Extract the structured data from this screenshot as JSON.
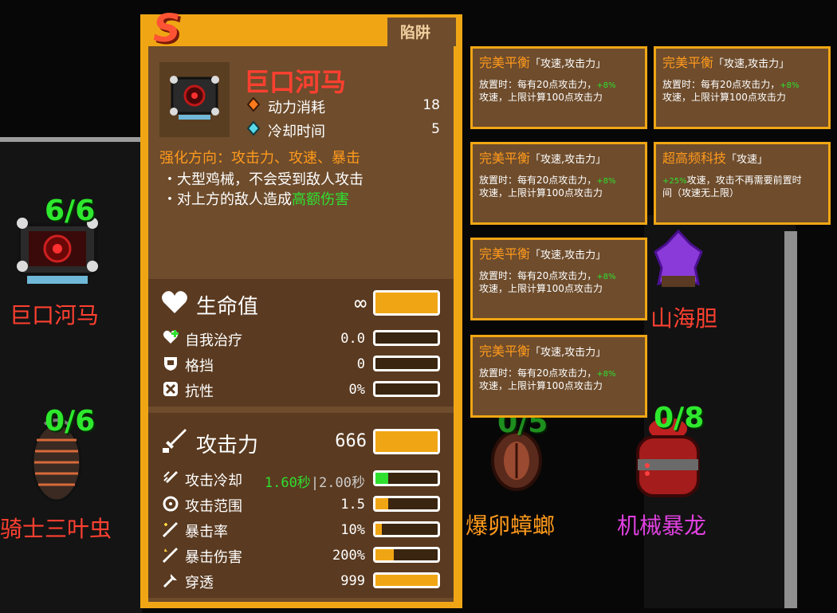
{
  "background": {
    "title_text": "",
    "units": [
      {
        "name": "巨口河马",
        "count": "6/6",
        "name_color": "#ff4030"
      },
      {
        "name": "骑士三叶虫",
        "count": "0/6",
        "name_color": "#ff4030"
      },
      {
        "name": "爆卵蟑螂",
        "count": "0/5",
        "name_color": "#ff9a1c"
      },
      {
        "name": "机械暴龙",
        "count": "0/8",
        "name_color": "#e040e0"
      },
      {
        "name": "山海胆",
        "count": "",
        "name_color": "#ff4030"
      }
    ]
  },
  "card": {
    "grade": "S",
    "tab": "陷阱",
    "title": "巨口河马",
    "energy_label": "动力消耗",
    "energy_value": "18",
    "cooldown_label": "冷却时间",
    "cooldown_value": "5",
    "enhance": "强化方向：攻击力、攻速、暴击",
    "desc1": "・大型鸡械，不会受到敌人攻击",
    "desc2_prefix": "・对上方的敌人造成",
    "desc2_highlight": "高额伤害"
  },
  "defense": {
    "title": "生命值",
    "value": "∞",
    "fill": 1.0,
    "rows": [
      {
        "label": "自我治疗",
        "value": "0.0",
        "fill": 0.0
      },
      {
        "label": "格挡",
        "value": "0",
        "fill": 0.0
      },
      {
        "label": "抗性",
        "value": "0%",
        "fill": 0.0
      }
    ]
  },
  "offense": {
    "title": "攻击力",
    "value": "666",
    "fill": 1.0,
    "attack_cd_label": "攻击冷却",
    "attack_cd_green": "1.60秒",
    "attack_cd_rest": "|2.00秒",
    "attack_cd_fill": 0.2,
    "rows": [
      {
        "label": "攻击范围",
        "value": "1.5",
        "fill": 0.2
      },
      {
        "label": "暴击率",
        "value": "10%",
        "fill": 0.1
      },
      {
        "label": "暴击伤害",
        "value": "200%",
        "fill": 0.3
      },
      {
        "label": "穿透",
        "value": "999",
        "fill": 1.0
      }
    ]
  },
  "perks": [
    {
      "name": "完美平衡",
      "tag": "「攻速,攻击力」",
      "line1_prefix": "放置时：每有20点攻击力，",
      "line1_green": "+8%",
      "line2": "攻速，上限计算100点攻击力"
    },
    {
      "name": "完美平衡",
      "tag": "「攻速,攻击力」",
      "line1_prefix": "放置时：每有20点攻击力，",
      "line1_green": "+8%",
      "line2": "攻速，上限计算100点攻击力"
    },
    {
      "name": "完美平衡",
      "tag": "「攻速,攻击力」",
      "line1_prefix": "放置时：每有20点攻击力，",
      "line1_green": "+8%",
      "line2": "攻速，上限计算100点攻击力"
    },
    {
      "name": "超高频科技",
      "tag": "「攻速」",
      "line1_prefix": "",
      "line1_green": "+25%",
      "line1_rest": "攻速，攻击不再需要前置时",
      "line2": "间（攻速无上限）"
    },
    {
      "name": "完美平衡",
      "tag": "「攻速,攻击力」",
      "line1_prefix": "放置时：每有20点攻击力，",
      "line1_green": "+8%",
      "line2": "攻速，上限计算100点攻击力"
    },
    {
      "name": "完美平衡",
      "tag": "「攻速,攻击力」",
      "line1_prefix": "放置时：每有20点攻击力，",
      "line1_green": "+8%",
      "line2": "攻速，上限计算100点攻击力"
    }
  ],
  "colors": {
    "accent": "#f0a614",
    "card_bg": "#6e4c2c",
    "red_title": "#ff4030",
    "green": "#2fe02f",
    "orange": "#ff9a1c"
  }
}
